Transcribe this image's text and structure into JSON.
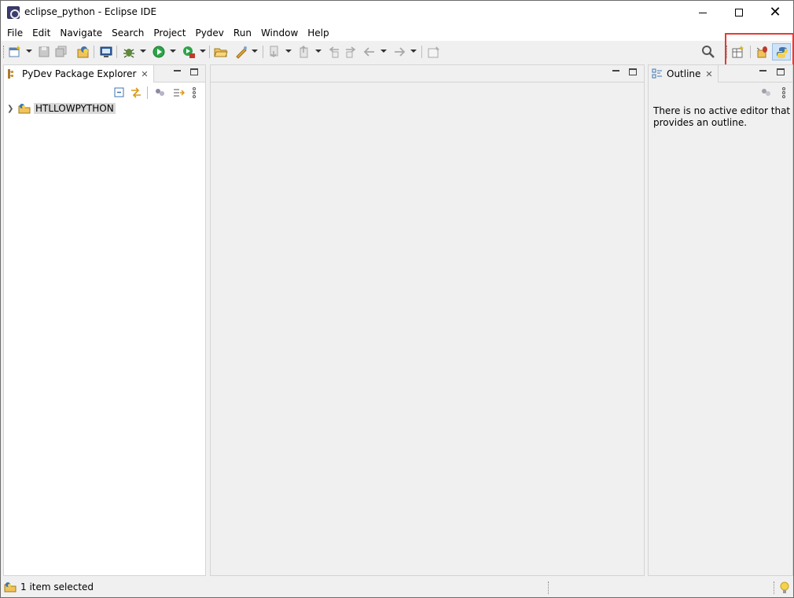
{
  "window": {
    "title": "eclipse_python - Eclipse IDE",
    "controls": {
      "minimize": "minimize",
      "maximize": "maximize",
      "close": "✕"
    }
  },
  "menu": [
    "File",
    "Edit",
    "Navigate",
    "Search",
    "Project",
    "Pydev",
    "Run",
    "Window",
    "Help"
  ],
  "package_explorer": {
    "tab_label": "PyDev Package Explorer",
    "tree": [
      {
        "label": "HTLLOWPYTHON",
        "expanded": false,
        "selected": true
      }
    ]
  },
  "outline": {
    "tab_label": "Outline",
    "message": "There is no active editor that provides an outline."
  },
  "status": {
    "text": "1 item selected"
  },
  "colors": {
    "highlight_box": "#e53935",
    "selection": "#d9d9d9",
    "active_perspective": "#cfe3f7"
  },
  "icons": {
    "toolbar": [
      "new-icon",
      "save-icon",
      "save-all-icon",
      "new-pydev-project-icon",
      "terminal-icon",
      "debug-icon",
      "run-icon",
      "external-tools-icon",
      "open-folder-icon",
      "edit-icon",
      "next-annotation-icon",
      "previous-annotation-icon",
      "last-edit-icon",
      "back-icon",
      "forward-icon",
      "pin-editor-icon"
    ],
    "perspectives": [
      "open-perspective-icon",
      "debug-perspective-icon",
      "python-perspective-icon"
    ]
  }
}
